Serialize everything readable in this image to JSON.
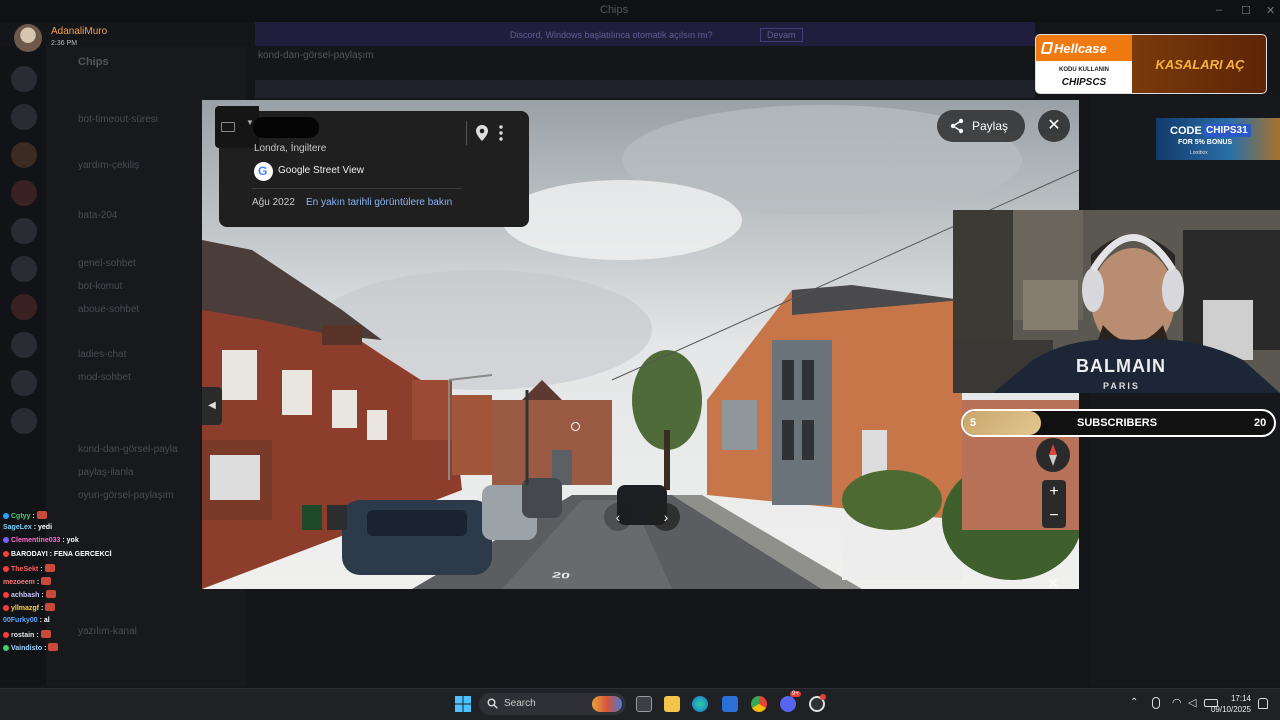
{
  "app": {
    "window_title": "Chips",
    "banner_text": "Discord, Windows başlatılınca otomatik açılsın mı?",
    "banner_action": "Devam",
    "server_name": "Chips",
    "channel_header": "kond-dan-görsel-paylaşım",
    "channels": [
      "bot-timeout-süresi",
      "yardım-çekiliş",
      "bata-204",
      "genel-sohbet",
      "bot-komut",
      "aboue-sohbet",
      "ladies-chat",
      "mod-sohbet",
      "kond-dan-görsel-payla",
      "paylaş-ilanla",
      "oyun-görsel-paylaşım",
      "yazılım-kanal"
    ]
  },
  "user_tag": {
    "name": "AdanaliMuro",
    "time": "2:36 PM"
  },
  "ad_hellcase": {
    "brand": "Hellcase",
    "line1": "KODU KULLANIN",
    "line2": "CHIPSCS",
    "cta": "KASALARI AÇ"
  },
  "ad_code": {
    "prefix": "CODE",
    "code": "CHIPS31",
    "bonus": "FOR 5% BONUS",
    "sponsor": "Lootbox"
  },
  "streetview": {
    "location": "Londra, İngiltere",
    "source": "Google Street View",
    "date": "Ağu 2022",
    "recent_link": "En yakın tarihli görüntülere bakın",
    "share_label": "Paylaş",
    "road_marking": "20"
  },
  "webcam": {
    "shirt_brand": "BALMAIN",
    "shirt_sub": "PARIS"
  },
  "subscribers": {
    "label": "SUBSCRIBERS",
    "current": "5",
    "goal": "20",
    "progress": 0.25
  },
  "chat": [
    {
      "user": "Cgtyy",
      "color": "#3fd06a",
      "msg": ":",
      "emote": true,
      "dot": "#2aa1ff"
    },
    {
      "user": "SageLex",
      "color": "#7dd3fc",
      "msg": ": yedi",
      "emote": false,
      "dot": ""
    },
    {
      "user": "Clementine033",
      "color": "#ff6ad5",
      "msg": ": yok",
      "emote": false,
      "dot": "#7b5cff"
    },
    {
      "user": "BARODAYI",
      "color": "#ffffff",
      "msg": ": FENA GERCEKCİ",
      "emote": false,
      "dot": "#ff3b3b"
    },
    {
      "user": "TheSekt",
      "color": "#ff5c5c",
      "msg": ":",
      "emote": true,
      "dot": "#ff3b3b"
    },
    {
      "user": "mezoeem",
      "color": "#ff7a7a",
      "msg": ":",
      "emote": true,
      "dot": ""
    },
    {
      "user": "achbash",
      "color": "#c8c8ff",
      "msg": ":",
      "emote": true,
      "dot": "#ff3b3b"
    },
    {
      "user": "yllmazgf",
      "color": "#ffd24a",
      "msg": ":",
      "emote": true,
      "dot": "#ff3b3b"
    },
    {
      "user": "00Furky00",
      "color": "#5aa9ff",
      "msg": ": al",
      "emote": false,
      "dot": ""
    },
    {
      "user": "rostain",
      "color": "#e6e6e6",
      "msg": ":",
      "emote": true,
      "dot": "#ff3b3b"
    },
    {
      "user": "Vaindisto",
      "color": "#9ad1ff",
      "msg": ":",
      "emote": true,
      "dot": "#3fd06a"
    }
  ],
  "taskbar": {
    "search_placeholder": "Search",
    "time": "17:14",
    "date": "09/10/2025",
    "discord_badge": "9+"
  },
  "colors": {
    "accent_orange": "#f07a12",
    "maps_link": "#8ab4f8",
    "gold": "#e3c891"
  }
}
